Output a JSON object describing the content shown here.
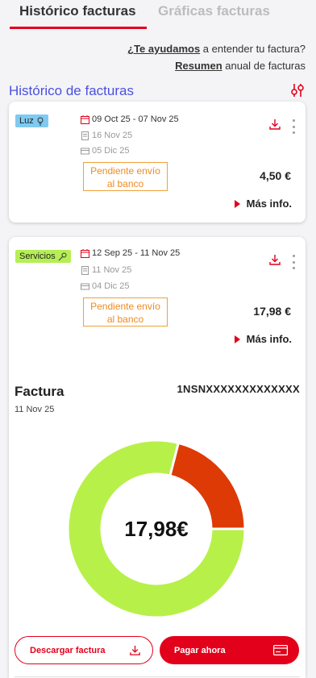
{
  "tabs": {
    "active": "Histórico facturas",
    "inactive": "Gráficas facturas"
  },
  "help": {
    "link1": "¿Te ayudamos",
    "text1": " a entender tu factura?",
    "link2": "Resumen",
    "text2": " anual de facturas"
  },
  "section_title": "Histórico de facturas",
  "invoices": [
    {
      "tag": "Luz",
      "tag_icon": "lightbulb-icon",
      "period": "09 Oct 25 - 07 Nov 25",
      "issued": "16 Nov 25",
      "charged": "05 Dic 25",
      "status_line1": "Pendiente envío",
      "status_line2": "al banco",
      "amount": "4,50 €",
      "more": "Más info."
    },
    {
      "tag": "Servicios",
      "tag_icon": "wrench-icon",
      "period": "12 Sep 25 - 11 Nov 25",
      "issued": "11 Nov 25",
      "charged": "04 Dic 25",
      "status_line1": "Pendiente envío",
      "status_line2": "al banco",
      "amount": "17,98 €",
      "more": "Más info."
    }
  ],
  "detail": {
    "title": "Factura",
    "date": "11 Nov 25",
    "code": "1NSNXXXXXXXXXXXXX",
    "total": "17,98€",
    "download_label": "Descargar factura",
    "pay_label": "Pagar ahora"
  },
  "colors": {
    "accent": "#e2001a",
    "segment_green": "#b8f04a",
    "segment_red": "#dd3a06",
    "title_blue": "#4a50e0",
    "pending_orange": "#f08a1e"
  },
  "donut_segments": [
    {
      "fraction": 0.79,
      "color": "#b8f04a"
    },
    {
      "fraction": 0.21,
      "color": "#dd3a06"
    }
  ]
}
